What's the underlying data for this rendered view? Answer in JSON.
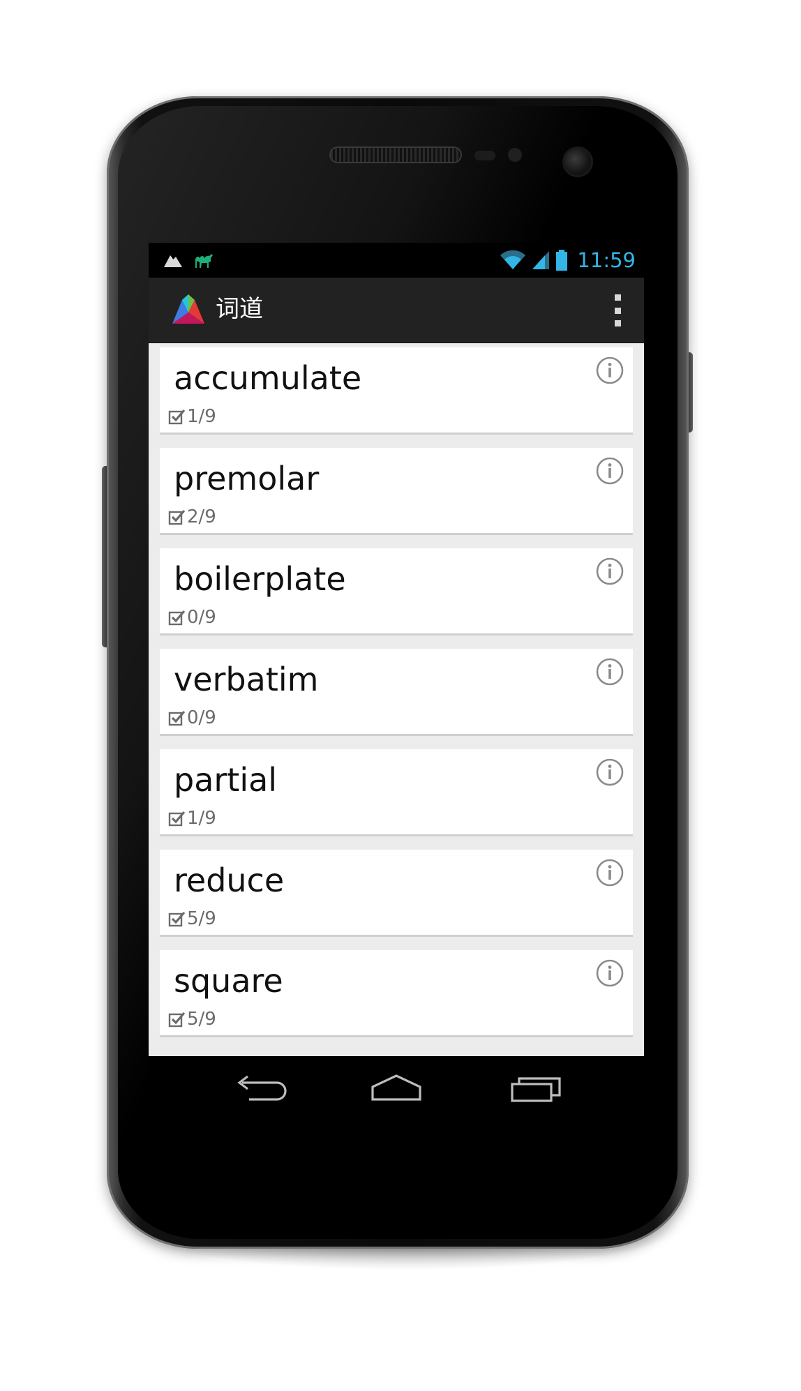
{
  "status_bar": {
    "time": "11:59",
    "icons": [
      "notification-mountain-icon",
      "notification-camel-icon",
      "wifi-icon",
      "signal-icon",
      "battery-icon"
    ],
    "accent_color": "#33b5e5"
  },
  "action_bar": {
    "title": "词道",
    "logo": "app-logo-icon",
    "overflow": "overflow-menu-icon"
  },
  "words": [
    {
      "word": "accumulate",
      "progress": "1/9"
    },
    {
      "word": "premolar",
      "progress": "2/9"
    },
    {
      "word": "boilerplate",
      "progress": "0/9"
    },
    {
      "word": "verbatim",
      "progress": "0/9"
    },
    {
      "word": "partial",
      "progress": "1/9"
    },
    {
      "word": "reduce",
      "progress": "5/9"
    },
    {
      "word": "square",
      "progress": "5/9"
    }
  ],
  "nav_bar": {
    "buttons": [
      "back-icon",
      "home-icon",
      "recents-icon"
    ]
  }
}
